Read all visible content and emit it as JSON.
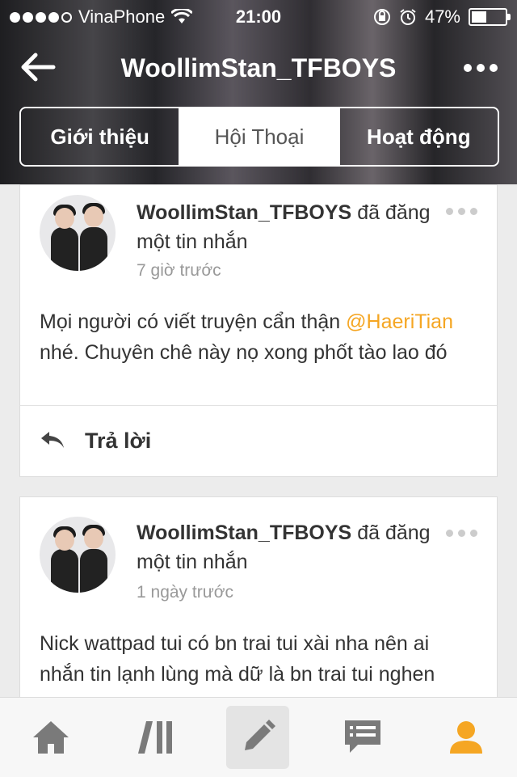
{
  "status_bar": {
    "carrier": "VinaPhone",
    "time": "21:00",
    "battery": "47%",
    "signal_bars_filled": 4,
    "signal_bars_total": 5
  },
  "nav": {
    "title": "WoollimStan_TFBOYS",
    "back_icon": "arrow-left-icon",
    "more_icon": "more-horizontal-icon"
  },
  "tabs": [
    {
      "label": "Giới thiệu",
      "active": false
    },
    {
      "label": "Hội Thoại",
      "active": true
    },
    {
      "label": "Hoạt động",
      "active": false
    }
  ],
  "posts": [
    {
      "author": "WoollimStan_TFBOYS",
      "action": "đã đăng một tin nhắn",
      "time": "7 giờ trước",
      "body_before": "Mọi người có viết truyện cẩn thận ",
      "mention": "@HaeriTian",
      "body_after": " nhé. Chuyên chê này nọ xong phốt tào lao đó",
      "reply_label": "Trả lời"
    },
    {
      "author": "WoollimStan_TFBOYS",
      "action": "đã đăng một tin nhắn",
      "time": "1 ngày trước",
      "body": "Nick wattpad tui có bn trai tui xài nha nên ai nhắn tin lạnh lùng mà dữ là bn trai tui nghen"
    }
  ],
  "bottom_nav": [
    {
      "icon": "home-icon",
      "active": false
    },
    {
      "icon": "library-icon",
      "active": false
    },
    {
      "icon": "pencil-icon",
      "active": true
    },
    {
      "icon": "messages-icon",
      "active": false
    },
    {
      "icon": "profile-icon",
      "active": false
    }
  ],
  "colors": {
    "accent": "#f5a623",
    "icon_gray": "#7a7a7a"
  }
}
